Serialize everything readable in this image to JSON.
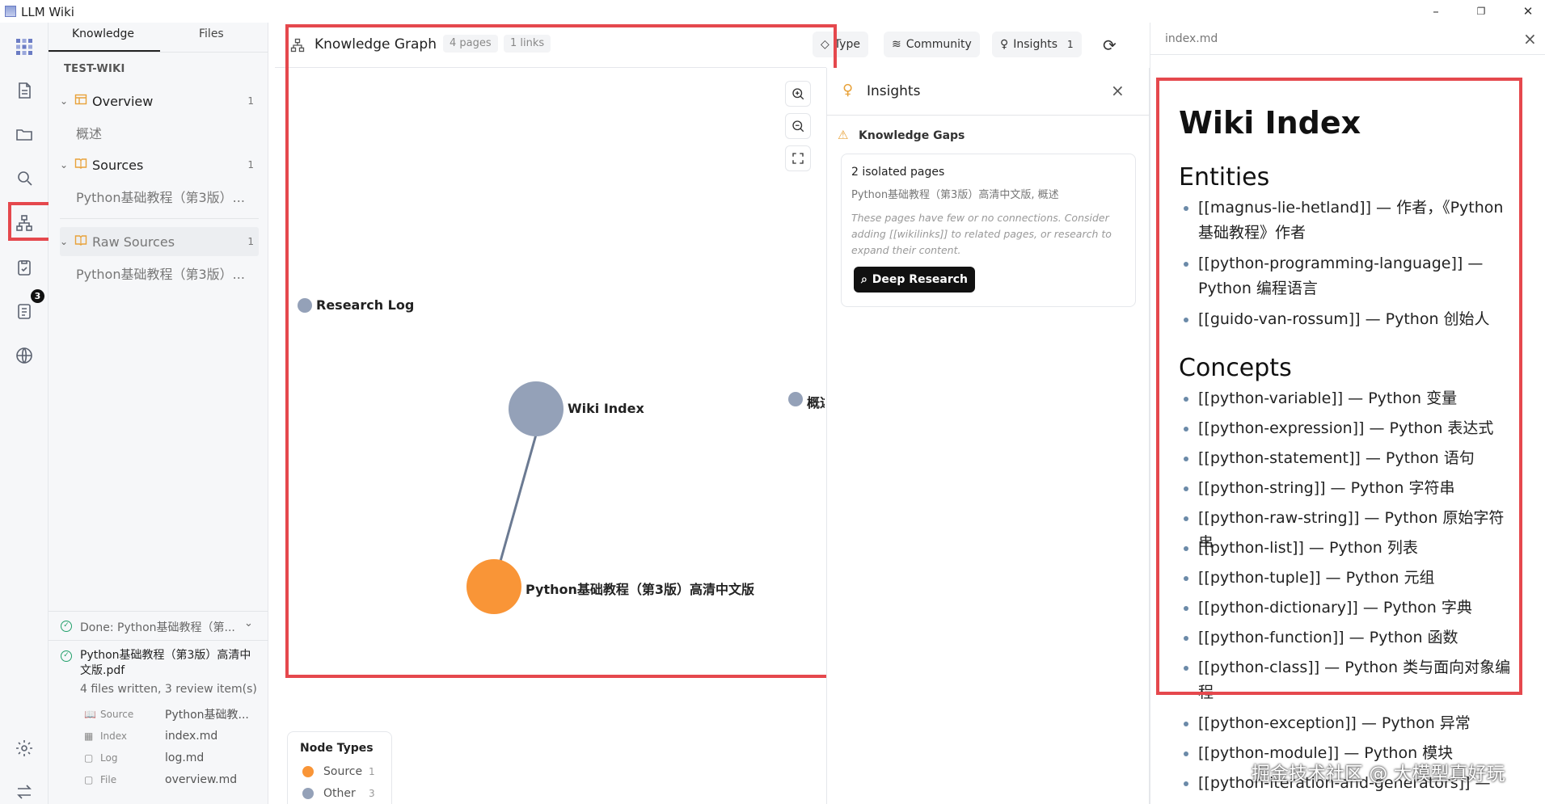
{
  "window": {
    "title": "LLM Wiki",
    "controls": [
      "–",
      "❐",
      "✕"
    ]
  },
  "rail": {
    "badge": "3"
  },
  "sidebar": {
    "tabs": [
      "Knowledge",
      "Files"
    ],
    "section": "TEST-WIKI",
    "groups": [
      {
        "label": "Overview",
        "count": "1",
        "child": "概述"
      },
      {
        "label": "Sources",
        "count": "1",
        "child": "Python基础教程（第3版）..."
      },
      {
        "label": "Raw Sources",
        "count": "1",
        "child": "Python基础教程（第3版）..."
      }
    ],
    "status": {
      "done": "Done: Python基础教程（第...",
      "file_name": "Python基础教程（第3版）高清中文版.pdf",
      "summary": "4 files written, 3 review item(s)",
      "files": [
        {
          "type": "Source",
          "value": "Python基础教..."
        },
        {
          "type": "Index",
          "value": "index.md"
        },
        {
          "type": "Log",
          "value": "log.md"
        },
        {
          "type": "File",
          "value": "overview.md"
        }
      ]
    }
  },
  "graph": {
    "title": "Knowledge Graph",
    "pages": "4 pages",
    "links": "1 links",
    "toolbar": {
      "type": "Type",
      "community": "Community",
      "insights": "Insights",
      "insights_count": "1"
    },
    "nodes": {
      "research_log": "Research Log",
      "wiki_index": "Wiki Index",
      "overview": "概述",
      "python_book": "Python基础教程（第3版）高清中文版"
    },
    "colors": {
      "source": "#f99537",
      "other": "#94a1b8",
      "edge": "#6b7a92"
    },
    "legend": {
      "title": "Node Types",
      "items": [
        {
          "label": "Source",
          "count": "1",
          "color": "#f99537"
        },
        {
          "label": "Other",
          "count": "3",
          "color": "#94a1b8"
        }
      ]
    }
  },
  "insights": {
    "title": "Insights",
    "section": "Knowledge Gaps",
    "card_title": "2 isolated pages",
    "card_pages": "Python基础教程（第3版）高清中文版, 概述",
    "card_note": "These pages have few or no connections. Consider adding [[wikilinks]] to related pages, or research to expand their content.",
    "button": "Deep Research"
  },
  "preview": {
    "tab": "index.md",
    "h1": "Wiki Index",
    "entities_title": "Entities",
    "entities": [
      "[[magnus-lie-hetland]] — 作者，《Python基础教程》作者",
      "[[python-programming-language]] — Python 编程语言",
      "[[guido-van-rossum]] — Python 创始人"
    ],
    "concepts_title": "Concepts",
    "concepts": [
      "[[python-variable]] — Python 变量",
      "[[python-expression]] — Python 表达式",
      "[[python-statement]] — Python 语句",
      "[[python-string]] — Python 字符串",
      "[[python-raw-string]] — Python 原始字符串",
      "[[python-list]] — Python 列表",
      "[[python-tuple]] — Python 元组",
      "[[python-dictionary]] — Python 字典",
      "[[python-function]] — Python 函数",
      "[[python-class]] — Python 类与面向对象编程",
      "[[python-exception]] — Python 异常",
      "[[python-module]] — Python 模块",
      "[[python-iteration-and-generators]] —"
    ]
  },
  "watermark": "掘金技术社区 @ 大模型真好玩",
  "highlight_color": "#e5484d"
}
